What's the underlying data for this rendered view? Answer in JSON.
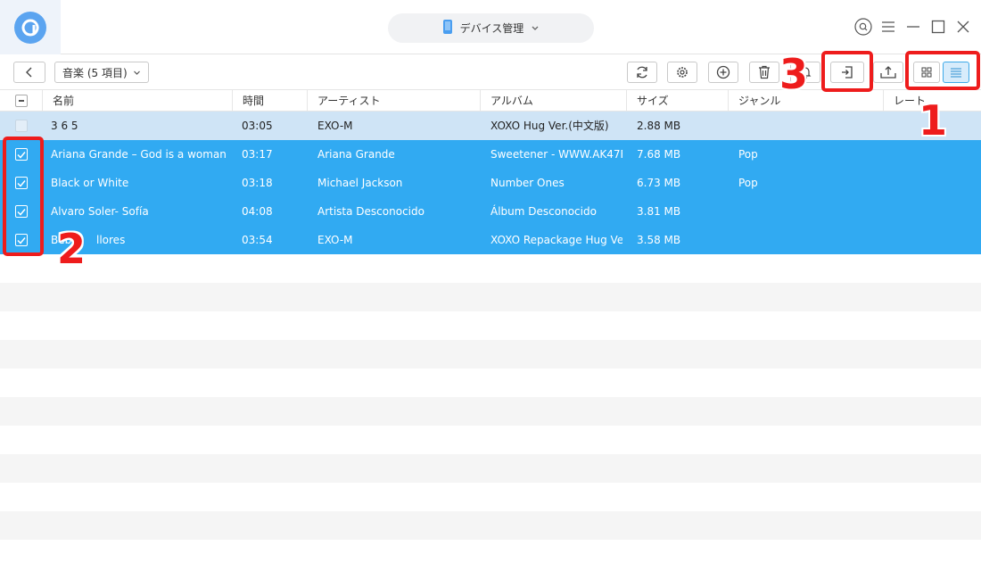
{
  "titlebar": {
    "device_label": "デバイス管理"
  },
  "toolbar": {
    "breadcrumb": "音楽 (5 項目)"
  },
  "table": {
    "columns": [
      "名前",
      "時間",
      "アーティスト",
      "アルバム",
      "サイズ",
      "ジャンル",
      "レート"
    ],
    "rows": [
      {
        "name": "3 6 5",
        "time": "03:05",
        "artist": "EXO-M",
        "album": "XOXO Hug Ver.(中文版)",
        "size": "2.88 MB",
        "genre": "",
        "state": "highlighted"
      },
      {
        "name": "Ariana Grande – God is a woman",
        "time": "03:17",
        "artist": "Ariana Grande",
        "album": "Sweetener - WWW.AK47F...",
        "size": "7.68 MB",
        "genre": "Pop",
        "state": "checked"
      },
      {
        "name": "Black or White",
        "time": "03:18",
        "artist": "Michael Jackson",
        "album": "Number Ones",
        "size": "6.73 MB",
        "genre": "Pop",
        "state": "checked"
      },
      {
        "name": "Alvaro Soler- Sofía",
        "time": "04:08",
        "artist": "Artista Desconocido",
        "album": " Álbum Desconocido",
        "size": "3.81 MB",
        "genre": "",
        "state": "checked"
      },
      {
        "name": "Bebe",
        "time": "03:54",
        "artist": "EXO-M",
        "album": "XOXO Repackage Hug Ve...",
        "size": "3.58 MB",
        "genre": "",
        "state": "checked",
        "name_suffix": "llores"
      }
    ]
  },
  "annotations": {
    "step1": "1",
    "step2": "2",
    "step3": "3"
  },
  "colors": {
    "selected_row": "#31aaf2",
    "highlight_row": "#cfe4f6",
    "annotation_red": "#ee1c1c",
    "logo_blue": "#5ba4f0"
  }
}
